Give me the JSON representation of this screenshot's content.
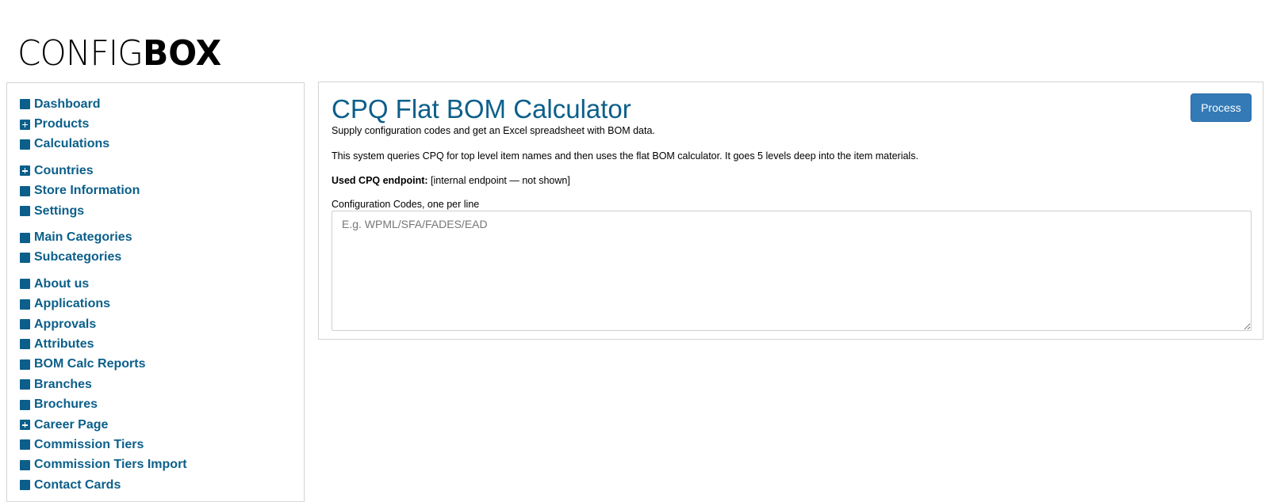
{
  "logo": {
    "light": "CONFIG",
    "bold": "BOX"
  },
  "sidebar": {
    "groups": [
      [
        {
          "label": "Dashboard",
          "icon": "square-icon"
        },
        {
          "label": "Products",
          "icon": "plus-square-icon"
        },
        {
          "label": "Calculations",
          "icon": "square-icon"
        }
      ],
      [
        {
          "label": "Countries",
          "icon": "plus-square-icon"
        },
        {
          "label": "Store Information",
          "icon": "square-icon"
        },
        {
          "label": "Settings",
          "icon": "square-icon"
        }
      ],
      [
        {
          "label": "Main Categories",
          "icon": "square-icon"
        },
        {
          "label": "Subcategories",
          "icon": "square-icon"
        }
      ],
      [
        {
          "label": "About us",
          "icon": "square-icon"
        },
        {
          "label": "Applications",
          "icon": "square-icon"
        },
        {
          "label": "Approvals",
          "icon": "square-icon"
        },
        {
          "label": "Attributes",
          "icon": "square-icon"
        },
        {
          "label": "BOM Calc Reports",
          "icon": "square-icon"
        },
        {
          "label": "Branches",
          "icon": "square-icon"
        },
        {
          "label": "Brochures",
          "icon": "square-icon"
        },
        {
          "label": "Career Page",
          "icon": "plus-square-icon"
        },
        {
          "label": "Commission Tiers",
          "icon": "square-icon"
        },
        {
          "label": "Commission Tiers Import",
          "icon": "square-icon"
        },
        {
          "label": "Contact Cards",
          "icon": "square-icon"
        }
      ]
    ]
  },
  "panel": {
    "title": "CPQ Flat BOM Calculator",
    "process_label": "Process",
    "intro": "Supply configuration codes and get an Excel spreadsheet with BOM data.",
    "description": "This system queries CPQ for top level item names and then uses the flat BOM calculator. It goes 5 levels deep into the item materials.",
    "endpoint_label": "Used CPQ endpoint:",
    "endpoint_value": " [internal endpoint — not shown]",
    "codes_label": "Configuration Codes, one per line",
    "codes_value": "",
    "codes_placeholder": "E.g. WPML/SFA/FADES/EAD"
  },
  "colors": {
    "accent": "#0b5f8a",
    "button": "#337ab7",
    "border": "#d7d7d7"
  }
}
